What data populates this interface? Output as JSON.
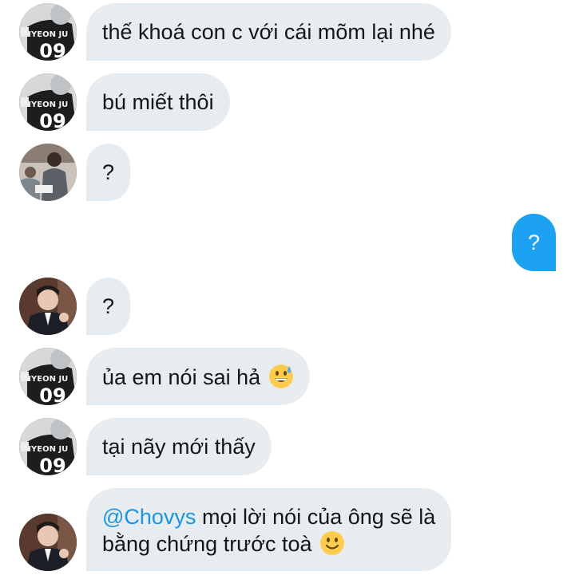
{
  "colors": {
    "incoming_bubble": "#e6ecf0",
    "outgoing_bubble": "#1da1f2",
    "mention": "#1b95e0",
    "text": "#14171a"
  },
  "messages": [
    {
      "sender": "hyeon-jun-jersey",
      "text": "thế khoá con c với cái mõm lại nhé"
    },
    {
      "sender": "hyeon-jun-jersey",
      "text": "bú miết thôi"
    },
    {
      "sender": "group-photo",
      "text": "?"
    },
    {
      "sender": "me",
      "text": "?"
    },
    {
      "sender": "suit-portrait",
      "text": "?"
    },
    {
      "sender": "hyeon-jun-jersey",
      "text": "ủa em nói sai hả",
      "emoji": "grinning-sweat-emoji"
    },
    {
      "sender": "hyeon-jun-jersey",
      "text": "tại nãy mới thấy"
    },
    {
      "sender": "suit-portrait",
      "mention": "@Chovys",
      "text_line1": " mọi lời nói của ông sẽ là",
      "text_line2": "bằng chứng trước toà",
      "emoji": "slightly-smiling-emoji"
    }
  ],
  "avatars": {
    "jersey_text": "HYEON JU",
    "jersey_number": "09"
  }
}
